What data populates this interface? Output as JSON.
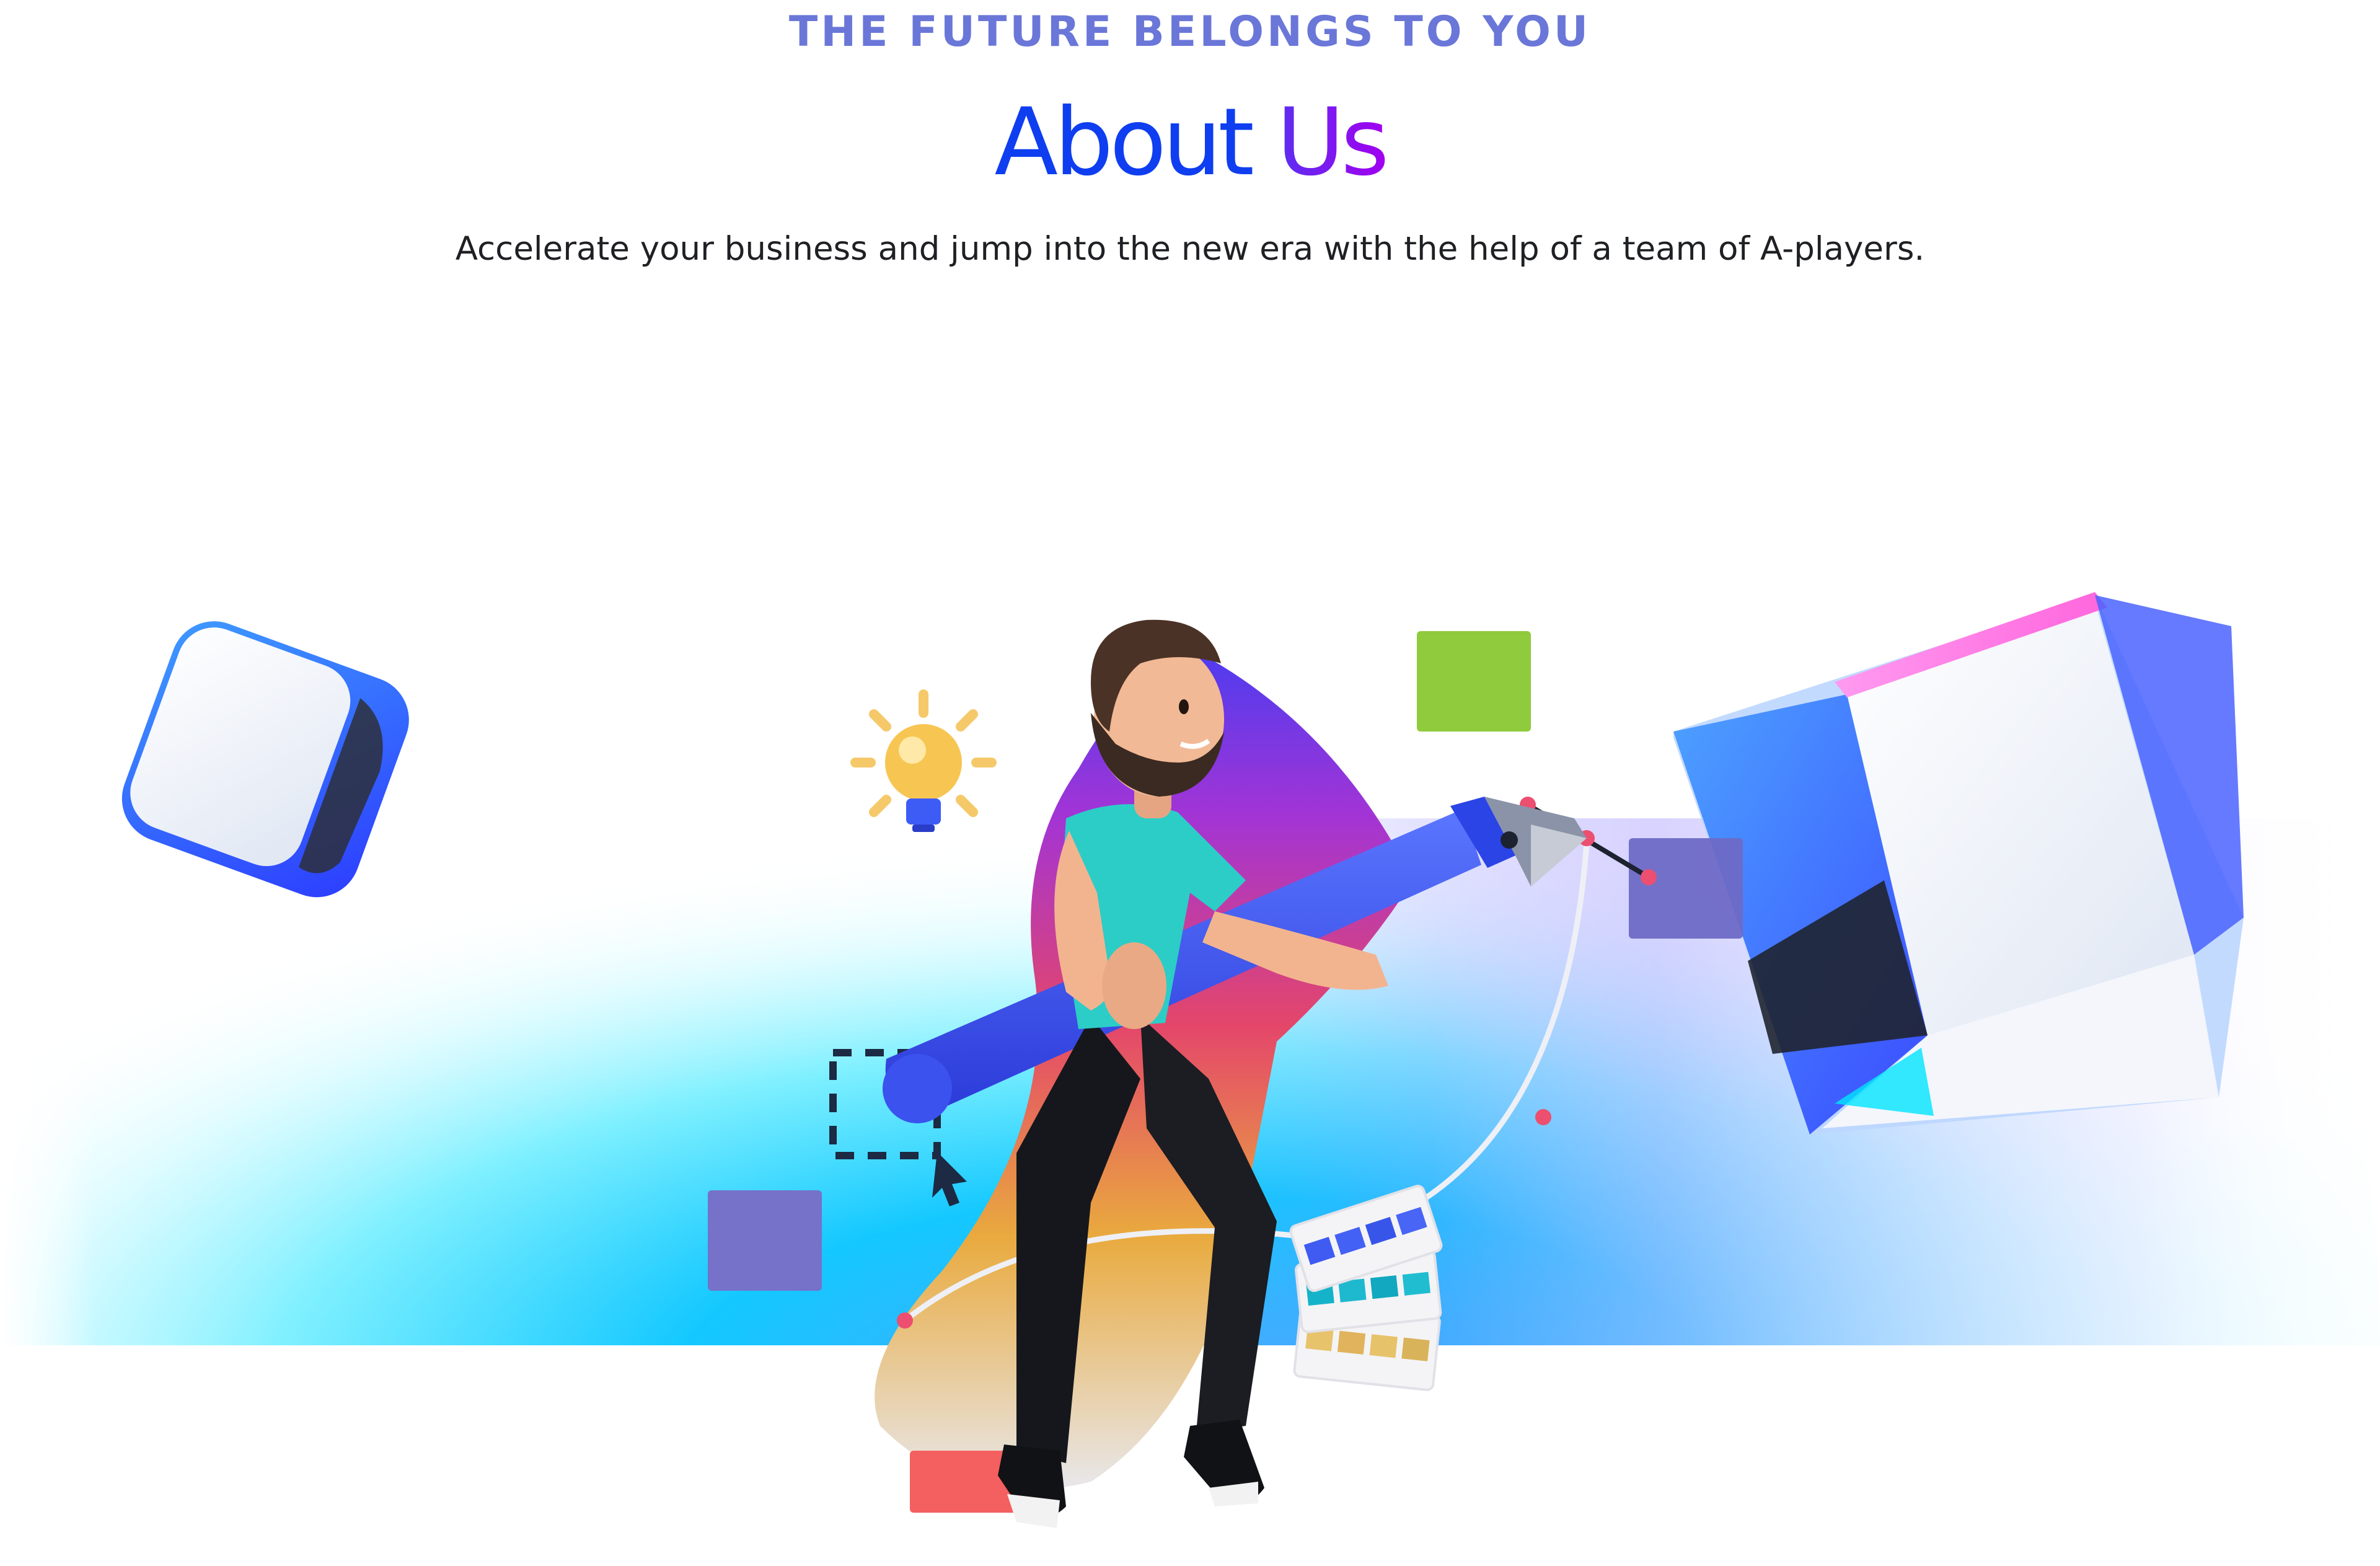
{
  "header": {
    "eyebrow": "THE FUTURE BELONGS TO YOU",
    "title_part1": "About",
    "title_part2": "Us",
    "subtitle": "Accelerate your business and jump into the new era with the help of a team of A-players."
  },
  "colors": {
    "eyebrow": "#6a77d8",
    "title_primary": "#0f3ef0",
    "title_accent": "#8a1cf0",
    "hero_cyan": "#04c6ff",
    "hero_violet": "#c8a8ff"
  },
  "illustration": {
    "icons": [
      "lightbulb-icon",
      "pen-tool-icon",
      "cursor-icon",
      "color-palette-icon",
      "cube-left",
      "cube-right"
    ]
  }
}
